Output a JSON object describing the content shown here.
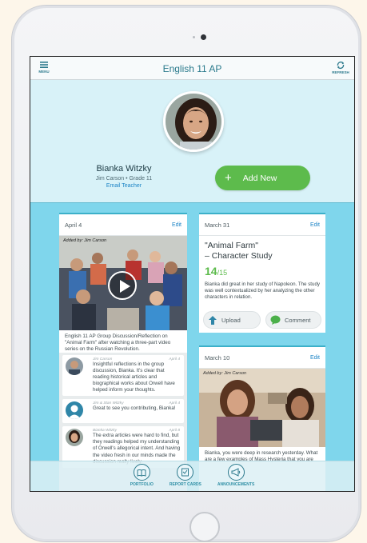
{
  "topbar": {
    "menu_label": "MENU",
    "title": "English 11 AP",
    "refresh_label": "REFRESH"
  },
  "profile": {
    "name": "Bianka Witzky",
    "meta": "Jim Carson • Grade 11",
    "email_link": "Email Teacher",
    "add_new_label": "Add New"
  },
  "card1": {
    "date": "April 4",
    "edit": "Edit",
    "added_by": "Added by: Jim Carson",
    "caption": "English 11 AP Group Discussion/Reflection on \"Animal Farm\" after watching a three-part video series on the Russian Revolution.",
    "comments": [
      {
        "author": "Jim Carson",
        "date": "April 4",
        "text": "Insightful reflections in the group discussion, Bianka. It's clear that reading historical articles and biographical works about Orwell have helped inform your thoughts."
      },
      {
        "author": "Jim & Stan Witzky",
        "date": "April 4",
        "text": "Great to see you contributing, Bianka!"
      },
      {
        "author": "Bianka Witzky",
        "date": "April 8",
        "text": "The extra articles were hard to find, but they readings helped my understanding of Orwell's allegorical intent. And having the video fresh in our minds made the discussion really lively."
      }
    ]
  },
  "card2": {
    "date": "March 31",
    "edit": "Edit",
    "title_line1": "\"Animal Farm\"",
    "title_line2": "– Character Study",
    "score": "14",
    "score_total": "/15",
    "note": "Bianka did great in her study of Napoleon. The study was well contextualized by her analyzing the other characters in relation.",
    "upload_label": "Upload",
    "comment_label": "Comment"
  },
  "card3": {
    "date": "March 10",
    "edit": "Edit",
    "added_by": "Added by: Jim Carson",
    "text": "Bianka, you were deep in research yesterday. What are a few examples of Mass Hysteria that you are"
  },
  "ghost": {
    "upload": "Upload",
    "edit": "Edit"
  },
  "tabs": [
    {
      "label": "PORTFOLIO"
    },
    {
      "label": "REPORT CARDS"
    },
    {
      "label": "ANNOUNCEMENTS"
    }
  ],
  "colors": {
    "accent": "#3cb0c9",
    "background": "#7fd6ec",
    "green": "#5dbb4c",
    "link": "#1c84c6"
  }
}
